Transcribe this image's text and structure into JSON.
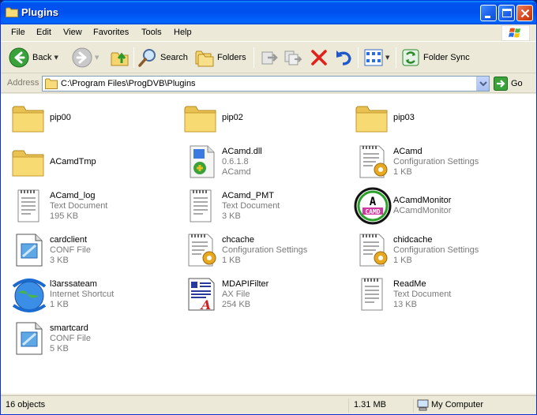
{
  "window": {
    "title": "Plugins"
  },
  "menu": [
    "File",
    "Edit",
    "View",
    "Favorites",
    "Tools",
    "Help"
  ],
  "toolbar": {
    "back": "Back",
    "search": "Search",
    "folders": "Folders",
    "folder_sync": "Folder Sync"
  },
  "address": {
    "label": "Address",
    "path": "C:\\Program Files\\ProgDVB\\Plugins",
    "go": "Go"
  },
  "files": [
    {
      "name": "pip00",
      "line2": "",
      "line3": "",
      "icon": "folder-icon"
    },
    {
      "name": "pip02",
      "line2": "",
      "line3": "",
      "icon": "folder-icon"
    },
    {
      "name": "pip03",
      "line2": "",
      "line3": "",
      "icon": "folder-icon"
    },
    {
      "name": "ACamdTmp",
      "line2": "",
      "line3": "",
      "icon": "folder-icon"
    },
    {
      "name": "ACamd.dll",
      "line2": "0.6.1.8",
      "line3": "ACamd",
      "icon": "dll-icon"
    },
    {
      "name": "ACamd",
      "line2": "Configuration Settings",
      "line3": "1 KB",
      "icon": "config-settings-icon"
    },
    {
      "name": "ACamd_log",
      "line2": "Text Document",
      "line3": "195 KB",
      "icon": "text-document-icon"
    },
    {
      "name": "ACamd_PMT",
      "line2": "Text Document",
      "line3": "3 KB",
      "icon": "text-document-icon"
    },
    {
      "name": "ACamdMonitor",
      "line2": "ACamdMonitor",
      "line3": "",
      "icon": "acamd-app-icon"
    },
    {
      "name": "cardclient",
      "line2": "CONF File",
      "line3": "3 KB",
      "icon": "conf-file-icon"
    },
    {
      "name": "chcache",
      "line2": "Configuration Settings",
      "line3": "1 KB",
      "icon": "config-settings-icon"
    },
    {
      "name": "chidcache",
      "line2": "Configuration Settings",
      "line3": "1 KB",
      "icon": "config-settings-icon"
    },
    {
      "name": "l3arssateam",
      "line2": "Internet Shortcut",
      "line3": "1 KB",
      "icon": "internet-shortcut-icon"
    },
    {
      "name": "MDAPIFilter",
      "line2": "AX File",
      "line3": "254 KB",
      "icon": "ax-file-icon"
    },
    {
      "name": "ReadMe",
      "line2": "Text Document",
      "line3": "13 KB",
      "icon": "text-document-icon"
    },
    {
      "name": "smartcard",
      "line2": "CONF File",
      "line3": "5 KB",
      "icon": "conf-file-icon"
    }
  ],
  "status": {
    "objects": "16 objects",
    "size": "1.31 MB",
    "location": "My Computer"
  },
  "colors": {
    "titlebar": "#0053ee",
    "chrome": "#ece9d8",
    "folder": "#f5d66e",
    "meta_text": "#7a7a7a"
  }
}
